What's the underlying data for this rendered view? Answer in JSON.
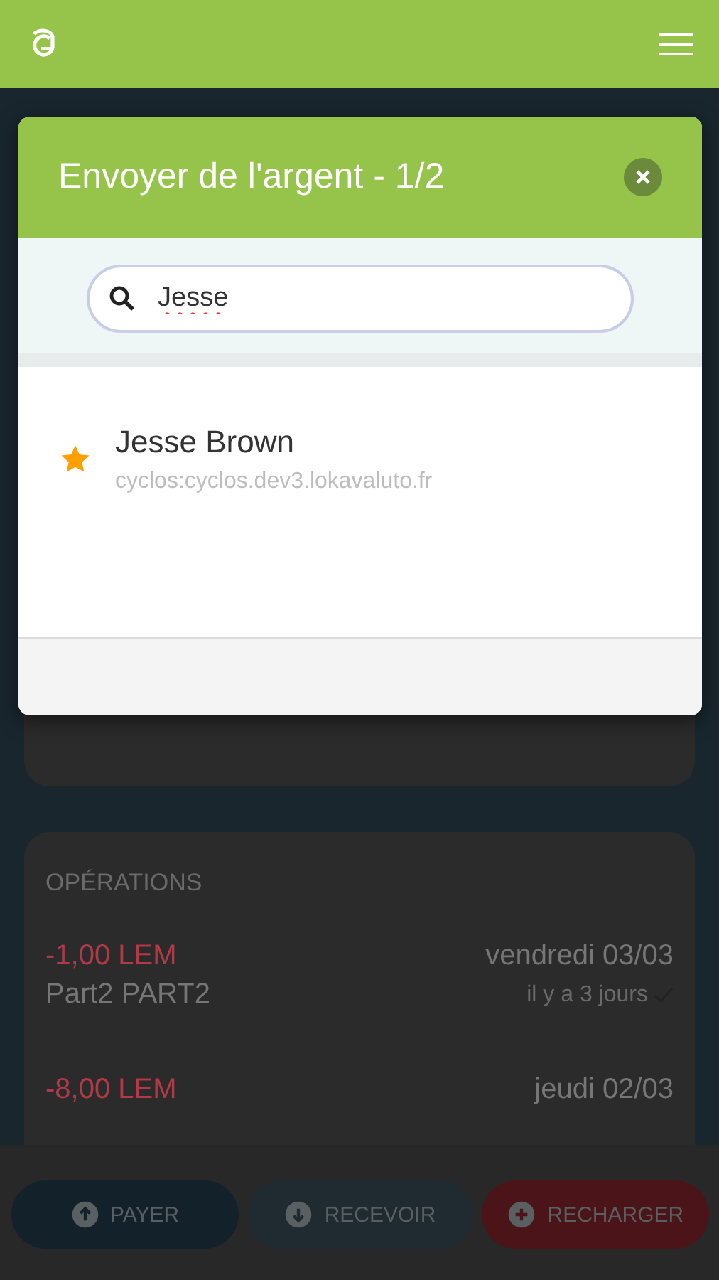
{
  "modal": {
    "title": "Envoyer de l'argent - 1/2",
    "search": {
      "value": "Jesse"
    },
    "results": [
      {
        "name": "Jesse Brown",
        "address": "cyclos:cyclos.dev3.lokavaluto.fr",
        "favorite": true
      }
    ]
  },
  "operations": {
    "title": "OPÉRATIONS",
    "items": [
      {
        "amount": "-1,00 LEM",
        "name": "Part2 PART2",
        "date": "vendredi 03/03",
        "ago": "il y a 3 jours",
        "confirmed": true
      },
      {
        "amount": "-8,00 LEM",
        "date": "jeudi 02/03"
      }
    ]
  },
  "actions": [
    {
      "kind": "pay",
      "label": "PAYER"
    },
    {
      "kind": "receive",
      "label": "RECEVOIR"
    },
    {
      "kind": "recharge",
      "label": "RECHARGER"
    }
  ]
}
